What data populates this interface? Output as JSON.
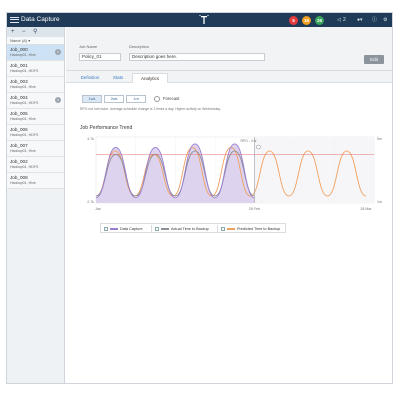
{
  "app": {
    "title": "Data Capture",
    "menu_icon": "hamburger-icon",
    "logo_icon": "t-logo-icon"
  },
  "topbar": {
    "badges": [
      {
        "value": "5",
        "color": "#e23b3b"
      },
      {
        "value": "15",
        "color": "#f0a020"
      },
      {
        "value": "26",
        "color": "#3aa55a"
      }
    ],
    "notifications": {
      "icon": "megaphone-icon",
      "count": "2"
    },
    "user_icon": "user-icon",
    "help_icon": "help-icon",
    "settings_icon": "gear-icon"
  },
  "sidebar": {
    "tools": {
      "add_icon": "plus-icon",
      "remove_icon": "minus-icon",
      "search_icon": "search-icon"
    },
    "sort_label": "Name (A)",
    "jobs": [
      {
        "name": "Job_000",
        "sub": "Hadoop01, Hive",
        "badge": "1",
        "active": true
      },
      {
        "name": "Job_001",
        "sub": "Hadoop01, HDFS",
        "badge": "",
        "active": false
      },
      {
        "name": "Job_003",
        "sub": "Hadoop01, Hive",
        "badge": "",
        "active": false
      },
      {
        "name": "Job_004",
        "sub": "Hadoop01, HDFS",
        "badge": "1",
        "active": false
      },
      {
        "name": "Job_005",
        "sub": "Hadoop01, Hive",
        "badge": "",
        "active": false
      },
      {
        "name": "Job_006",
        "sub": "Hadoop01, HDFS",
        "badge": "",
        "active": false
      },
      {
        "name": "Job_007",
        "sub": "Hadoop01, Hive",
        "badge": "",
        "active": false
      },
      {
        "name": "Job_002",
        "sub": "Hadoop01, HDFS",
        "badge": "",
        "active": false
      },
      {
        "name": "Job_008",
        "sub": "Hadoop01, Hive",
        "badge": "",
        "active": false
      }
    ]
  },
  "header": {
    "job_name_label": "Job Name",
    "job_name_value": "Policy_01",
    "description_label": "Description",
    "description_value": "Description goes here.",
    "edit_label": "Edit"
  },
  "tabs": [
    {
      "label": "Definition",
      "active": false
    },
    {
      "label": "Stats",
      "active": false
    },
    {
      "label": "Analytics",
      "active": true
    }
  ],
  "range": {
    "options": [
      "1wk",
      "2wk",
      "1m"
    ],
    "selected": "1wk",
    "forecast_label": "Forecast"
  },
  "note": "RPO not met twice.   Average schedule change is 2 times a day.   Higher activity on Wednesday.",
  "chart_data": {
    "type": "line",
    "title": "Job Performance Trend",
    "x_ticks": [
      "Jan",
      "28 Feb",
      "28 Mar"
    ],
    "y_left_ticks": [
      "4.7k",
      "2.7k"
    ],
    "y_right_ticks": [
      "5m",
      "1m"
    ],
    "rpo_label": "RPO - 4 hr",
    "series": [
      {
        "name": "Data Capture",
        "color": "#9b7fd0",
        "fill": "#ddd3ef",
        "values": [
          2.75,
          4.2,
          2.75,
          4.2,
          2.75,
          4.3,
          2.75,
          4.3,
          2.75
        ]
      },
      {
        "name": "Actual Time to Backup",
        "color": "#8a9096",
        "values": [
          2.8,
          4.0,
          2.8,
          4.0,
          2.8,
          4.1,
          2.8,
          4.1,
          2.8
        ]
      },
      {
        "name": "Predicted Time to Backup",
        "color": "#f0a060",
        "values": [
          2.8,
          4.1,
          2.8,
          4.0,
          2.8,
          4.2,
          2.8,
          4.2,
          2.8,
          4.1,
          2.8,
          4.1,
          2.8,
          4.1,
          2.8
        ]
      }
    ]
  },
  "legend": [
    {
      "label": "Data Capture",
      "color": "#9b7fd0"
    },
    {
      "label": "Actual Time to Backup",
      "color": "#8a9096"
    },
    {
      "label": "Predicted Time to Backup",
      "color": "#f0a060"
    }
  ]
}
